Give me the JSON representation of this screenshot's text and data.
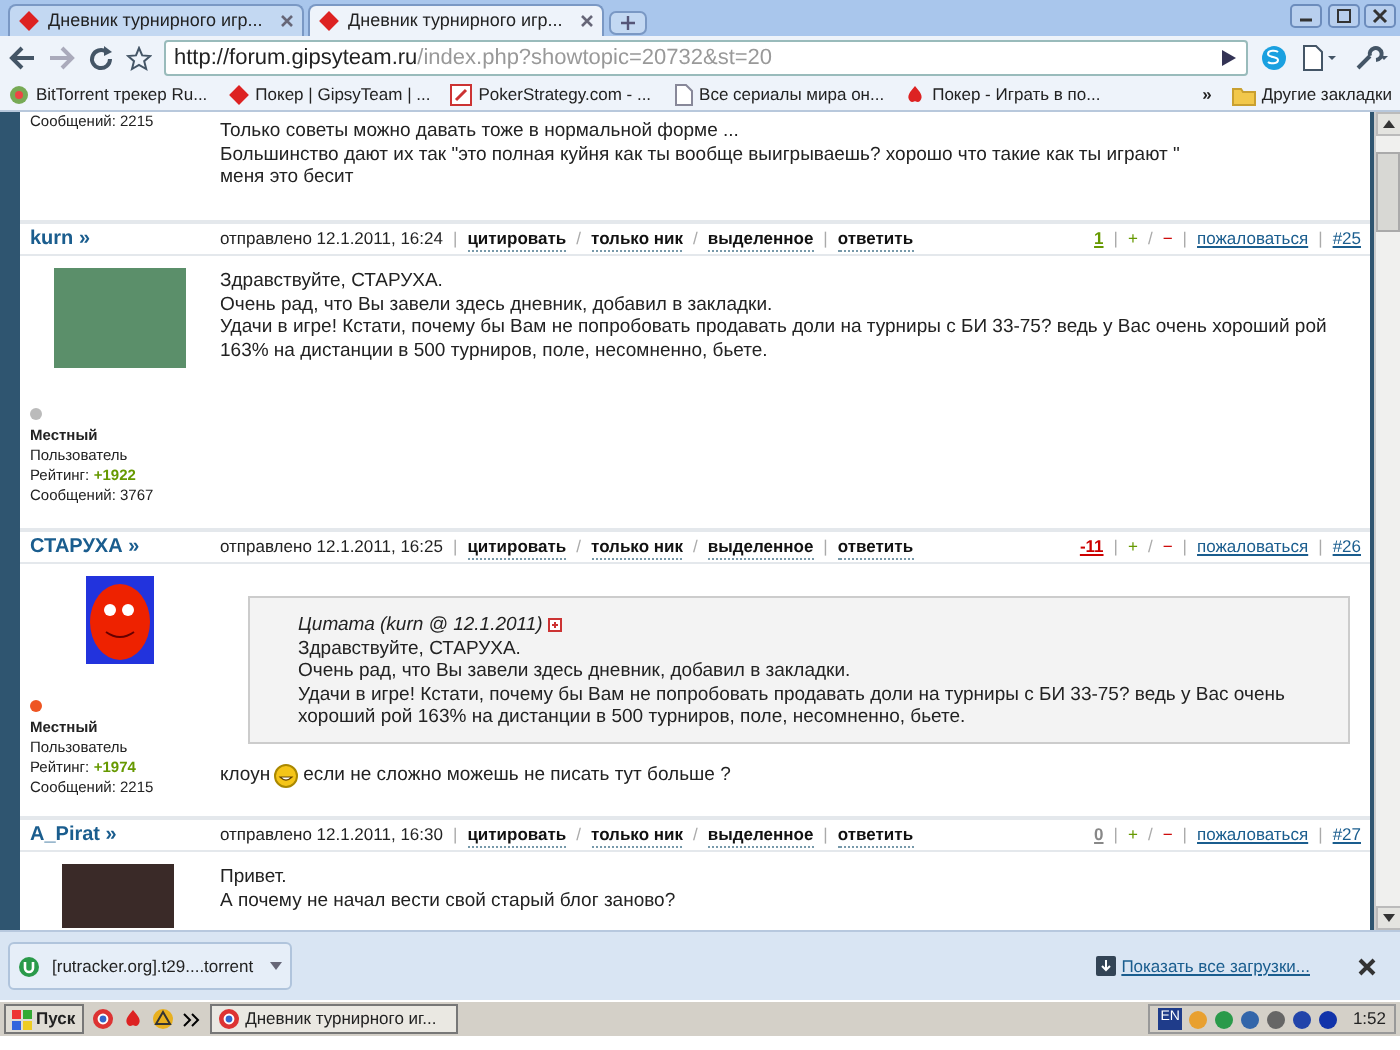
{
  "browser": {
    "tabs": [
      {
        "label": "Дневник турнирного игр...",
        "selected": false
      },
      {
        "label": "Дневник турнирного игр...",
        "selected": true
      }
    ],
    "address": {
      "host": "http://forum.gipsyteam.ru",
      "path": "/index.php?showtopic=20732&st=20"
    },
    "bookmarks": [
      "BitTorrent трекер Ru...",
      "Покер | GipsyTeam | ...",
      "PokerStrategy.com - ...",
      "Все сериалы мира он...",
      "Покер - Играть в по..."
    ],
    "bookmarks_more": "»",
    "other_bookmarks": "Другие закладки"
  },
  "top_post": {
    "author_messages": "Сообщений: 2215",
    "lines": [
      "Только советы можно давать тоже в нормальной форме ...",
      "Большинство дают их так \"это полная куйня как ты вообще выигрываешь? хорошо что такие как ты играют \"",
      "меня это бесит"
    ]
  },
  "posts": [
    {
      "author": "kurn »",
      "date": "отправлено 12.1.2011, 16:24",
      "actions": [
        "цитировать",
        "только ник",
        "выделенное",
        "ответить"
      ],
      "action_separators": [
        "|",
        "/",
        "/",
        "|"
      ],
      "vote_separators": [
        "|",
        "/",
        "|",
        "|"
      ],
      "rating": {
        "value": "1",
        "color": "#669900"
      },
      "plus": "+",
      "minus": "−",
      "report": "пожаловаться",
      "number": "#25",
      "avatar": {
        "kind": "photo"
      },
      "status": {
        "color": "#bbbbbb"
      },
      "group": "Местный",
      "role": "Пользователь",
      "rating_label": "Рейтинг:",
      "rating_value": "+1922",
      "messages": "Сообщений: 3767",
      "lines": [
        "Здравствуйте, СТАРУХА.",
        "Очень рад, что Вы завели здесь дневник, добавил в закладки.",
        "Удачи в игре! Кстати, почему бы Вам не попробовать продавать доли на турниры с БИ 33-75? ведь у Вас очень хороший рой 163% на дистанции в 500 турниров, поле, несомненно, бьете."
      ]
    },
    {
      "author": "СТАРУХА »",
      "date": "отправлено 12.1.2011, 16:25",
      "actions": [
        "цитировать",
        "только ник",
        "выделенное",
        "ответить"
      ],
      "action_separators": [
        "|",
        "/",
        "/",
        "|"
      ],
      "vote_separators": [
        "|",
        "/",
        "|",
        "|"
      ],
      "rating": {
        "value": "-11",
        "color": "#cc0000"
      },
      "plus": "+",
      "minus": "−",
      "report": "пожаловаться",
      "number": "#26",
      "avatar": {
        "kind": "cartoon"
      },
      "status": {
        "color": "#ee5522"
      },
      "group": "Местный",
      "role": "Пользователь",
      "rating_label": "Рейтинг:",
      "rating_value": "+1974",
      "messages": "Сообщений: 2215",
      "quote": {
        "title": "Цитата (kurn @ 12.1.2011)",
        "lines": [
          "Здравствуйте, СТАРУХА.",
          "Очень рад, что Вы завели здесь дневник, добавил в закладки.",
          "Удачи в игре! Кстати, почему бы Вам не попробовать продавать доли на турниры с БИ 33-75? ведь у Вас очень хороший рой 163% на дистанции в 500 турниров, поле, несомненно, бьете."
        ]
      },
      "reply": {
        "before": "клоун",
        "after": "если не сложно можешь не писать тут больше ?"
      }
    },
    {
      "author": "A_Pirat »",
      "date": "отправлено 12.1.2011, 16:30",
      "actions": [
        "цитировать",
        "только ник",
        "выделенное",
        "ответить"
      ],
      "action_separators": [
        "|",
        "/",
        "/",
        "|"
      ],
      "vote_separators": [
        "|",
        "/",
        "|",
        "|"
      ],
      "rating": {
        "value": "0",
        "color": "#888888"
      },
      "plus": "+",
      "minus": "−",
      "report": "пожаловаться",
      "number": "#27",
      "avatar": {
        "kind": "photo"
      },
      "lines": [
        "Привет.",
        "А почему не начал вести свой старый блог заново?"
      ]
    }
  ],
  "download_bar": {
    "file": "[rutracker.org].t29....torrent",
    "show_all": "Показать все загрузки..."
  },
  "taskbar": {
    "start": "Пуск",
    "window": "Дневник турнирного иг...",
    "lang": "EN",
    "time": "1:52"
  }
}
